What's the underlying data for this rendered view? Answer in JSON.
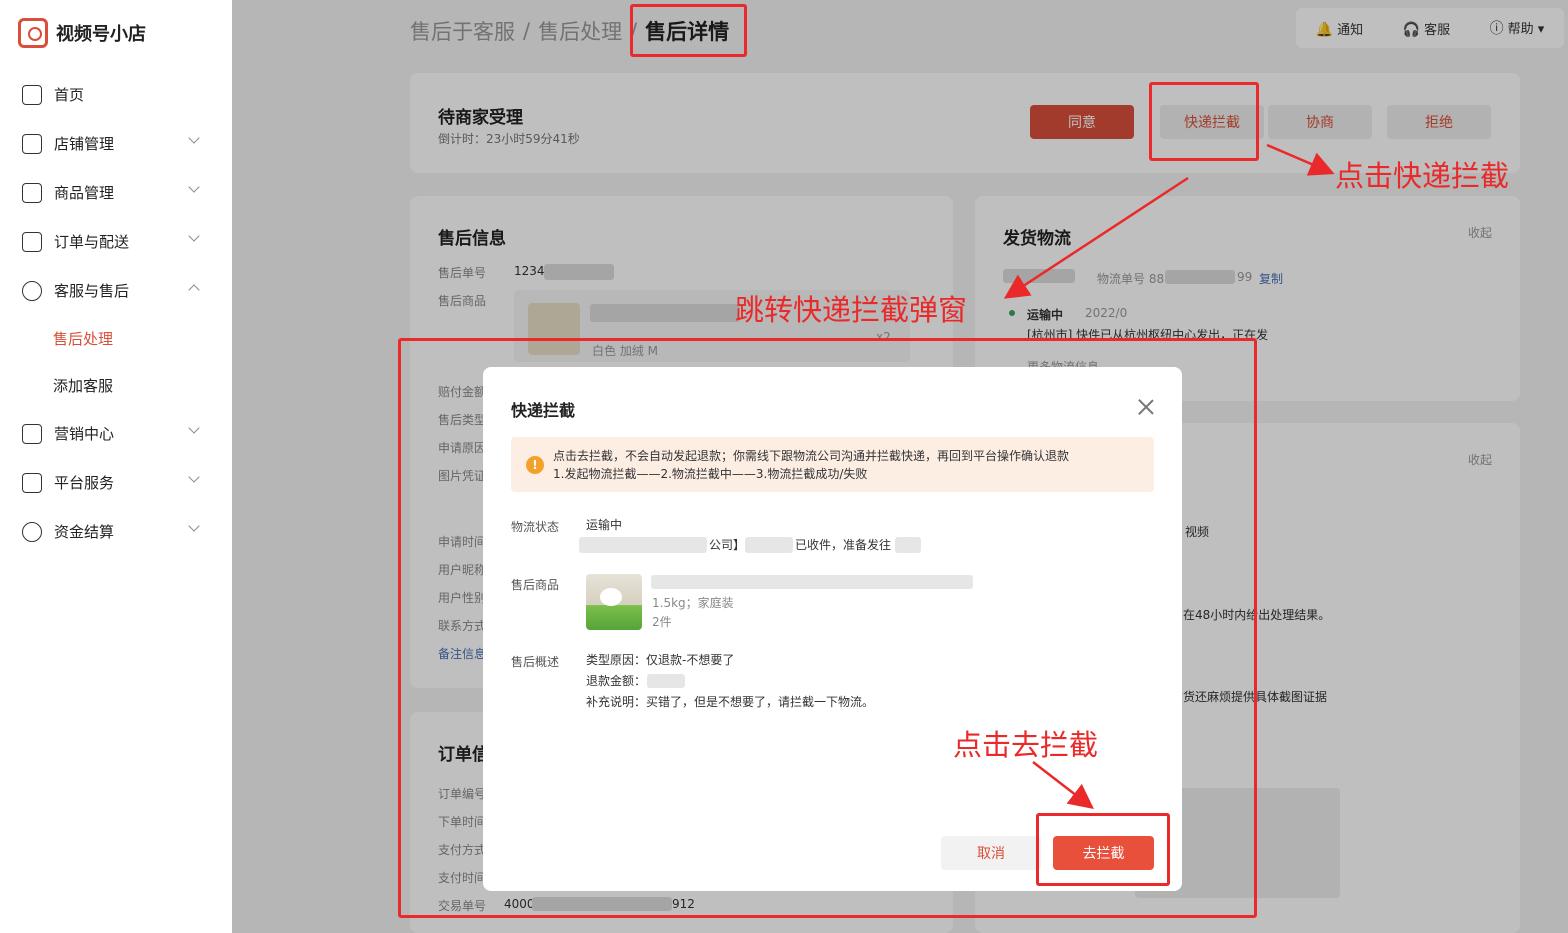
{
  "app": {
    "name": "视频号小店"
  },
  "sidebar": {
    "items": [
      {
        "label": "首页",
        "icon": "home-icon"
      },
      {
        "label": "店铺管理",
        "icon": "store-icon"
      },
      {
        "label": "商品管理",
        "icon": "bag-icon"
      },
      {
        "label": "订单与配送",
        "icon": "order-icon"
      },
      {
        "label": "客服与售后",
        "icon": "headset-icon"
      },
      {
        "label": "营销中心",
        "icon": "marketing-icon"
      },
      {
        "label": "平台服务",
        "icon": "service-icon"
      },
      {
        "label": "资金结算",
        "icon": "yuan-icon"
      }
    ],
    "sub_items": [
      "售后处理",
      "添加客服"
    ]
  },
  "breadcrumb": [
    "售后于客服",
    "售后处理",
    "售后详情"
  ],
  "topbar": {
    "notify": "通知",
    "service": "客服",
    "help": "帮助"
  },
  "status": {
    "title": "待商家受理",
    "countdown": "倒计时：23小时59分41秒",
    "agree": "同意",
    "intercept": "快递拦截",
    "negotiate": "协商",
    "reject": "拒绝"
  },
  "aftersale": {
    "title": "售后信息",
    "order_label": "售后单号",
    "order_value": "1234",
    "goods_label": "售后商品",
    "goods_spec": "白色 加绒 M",
    "goods_qty": "x2",
    "labels": [
      "赔付金额",
      "售后类型",
      "申请原因",
      "图片凭证",
      "申请时间",
      "用户昵称",
      "用户性别",
      "联系方式"
    ],
    "note": "备注信息"
  },
  "order_info": {
    "title": "订单信",
    "labels": [
      "订单编号",
      "下单时间",
      "支付方式",
      "支付时间",
      "交易单号"
    ],
    "trade_no": "4000",
    "trade_suffix": "912"
  },
  "logistics": {
    "title": "发货物流",
    "collapse": "收起",
    "tracking_label": "物流单号 88",
    "tracking_suffix": "99",
    "copy": "复制",
    "state": "运输中",
    "date": "2022/0",
    "detail": "[杭州市] 快件已从杭州枢纽中心发出，正在发",
    "more": "更多物流信息"
  },
  "right2": {
    "collapse": "收起",
    "text1": "视频",
    "text2": "在48小时内给出处理结果。",
    "text3": "货还麻烦提供具体截图证据"
  },
  "dialog": {
    "title": "快递拦截",
    "alert_line1": "点击去拦截，不会自动发起退款；你需线下跟物流公司沟通并拦截快递，再回到平台操作确认退款",
    "alert_line2": "1.发起物流拦截——2.物流拦截中——3.物流拦截成功/失败",
    "logistics_label": "物流状态",
    "logistics_state": "运输中",
    "logistics_detail_a": "公司】",
    "logistics_detail_b": "已收件，准备发往",
    "goods_label": "售后商品",
    "goods_spec": "1.5kg；家庭装",
    "goods_qty": "2件",
    "summary_label": "售后概述",
    "summary_type": "类型原因：仅退款-不想要了",
    "summary_amount": "退款金额：",
    "summary_note": "补充说明：买错了，但是不想要了，请拦截一下物流。",
    "cancel": "取消",
    "confirm": "去拦截"
  },
  "annotations": {
    "a1": "点击快递拦截",
    "a2": "跳转快递拦截弹窗",
    "a3": "点击去拦截"
  },
  "colors": {
    "accent": "#d94f3a",
    "annotation": "#ea2a2a"
  }
}
